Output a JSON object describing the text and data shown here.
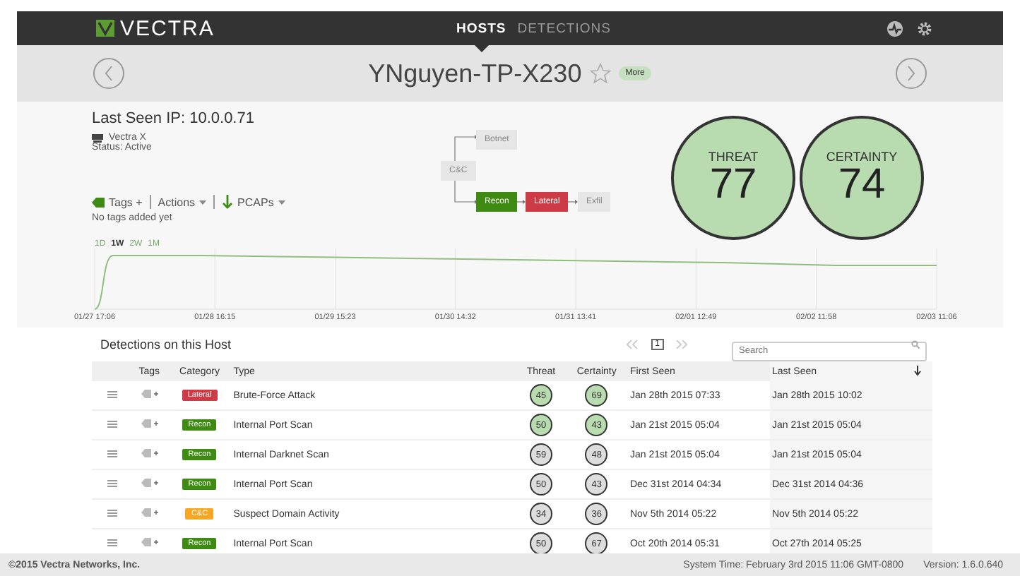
{
  "nav": {
    "brand": "VECTRA",
    "tabs": [
      {
        "label": "HOSTS",
        "selected": true
      },
      {
        "label": "DETECTIONS",
        "selected": false
      }
    ]
  },
  "host": {
    "name": "YNguyen-TP-X230",
    "starred": false,
    "more": "More"
  },
  "summary": {
    "last_seen_ip": "Last Seen IP: 10.0.0.71",
    "device": "Vectra X",
    "status": "Status: Active",
    "tags": "Tags +",
    "actions": "Actions",
    "pcaps": "PCAPs",
    "no_tags": "No tags added yet"
  },
  "kill_chain": [
    {
      "label": "Botnet",
      "active": false,
      "color": "#e6e6e6"
    },
    {
      "label": "C&C",
      "active": false,
      "color": "#e6e6e6"
    },
    {
      "label": "Recon",
      "active": true,
      "color": "#3f8a12"
    },
    {
      "label": "Lateral",
      "active": true,
      "color": "#cd3c46"
    },
    {
      "label": "Exfil",
      "active": false,
      "color": "#e6e6e6"
    }
  ],
  "scores": [
    {
      "label": "THREAT",
      "value": "77"
    },
    {
      "label": "CERTAINTY",
      "value": "74"
    }
  ],
  "timeline": {
    "ranges": [
      {
        "label": "1D",
        "selected": false
      },
      {
        "label": "1W",
        "selected": true
      },
      {
        "label": "2W",
        "selected": false
      },
      {
        "label": "1M",
        "selected": false
      }
    ],
    "x_labels": [
      "01/27 17:06",
      "01/28 16:15",
      "01/29 15:23",
      "01/30 14:32",
      "01/31 13:41",
      "02/01 12:49",
      "02/02 11:58",
      "02/03 11:06"
    ]
  },
  "detections": {
    "title": "Detections on this Host",
    "page": "1",
    "search": {
      "placeholder": "Search"
    },
    "columns": [
      "Tags",
      "Category",
      "Type",
      "Threat",
      "Certainty",
      "First Seen",
      "Last Seen"
    ],
    "rows": [
      {
        "category": "Lateral",
        "color": "#cd3c46",
        "type": "Brute-Force Attack",
        "threat": "45",
        "threat_high": true,
        "certainty": "69",
        "certainty_high": true,
        "first_seen": "Jan 28th 2015 07:33",
        "last_seen": "Jan 28th 2015 10:02"
      },
      {
        "category": "Recon",
        "color": "#3f8a12",
        "type": "Internal Port Scan",
        "threat": "50",
        "threat_high": true,
        "certainty": "43",
        "certainty_high": true,
        "first_seen": "Jan 21st 2015 05:04",
        "last_seen": "Jan 21st 2015 05:04"
      },
      {
        "category": "Recon",
        "color": "#3f8a12",
        "type": "Internal Darknet Scan",
        "threat": "59",
        "threat_high": false,
        "certainty": "48",
        "certainty_high": false,
        "first_seen": "Jan 21st 2015 05:04",
        "last_seen": "Jan 21st 2015 05:04"
      },
      {
        "category": "Recon",
        "color": "#3f8a12",
        "type": "Internal Port Scan",
        "threat": "50",
        "threat_high": false,
        "certainty": "43",
        "certainty_high": false,
        "first_seen": "Dec 31st 2014 04:34",
        "last_seen": "Dec 31st 2014 04:36"
      },
      {
        "category": "C&C",
        "color": "#f5a623",
        "type": "Suspect Domain Activity",
        "threat": "34",
        "threat_high": false,
        "certainty": "36",
        "certainty_high": false,
        "first_seen": "Nov 5th 2014 05:22",
        "last_seen": "Nov 5th 2014 05:22"
      },
      {
        "category": "Recon",
        "color": "#3f8a12",
        "type": "Internal Port Scan",
        "threat": "50",
        "threat_high": false,
        "certainty": "67",
        "certainty_high": false,
        "first_seen": "Oct 20th 2014 05:31",
        "last_seen": "Oct 27th 2014 05:25"
      }
    ]
  },
  "footer": {
    "copyright": "©2015 Vectra Networks, Inc.",
    "system_time": "System Time: February 3rd 2015 11:06 GMT-0800",
    "version": "Version: 1.6.0.640"
  }
}
